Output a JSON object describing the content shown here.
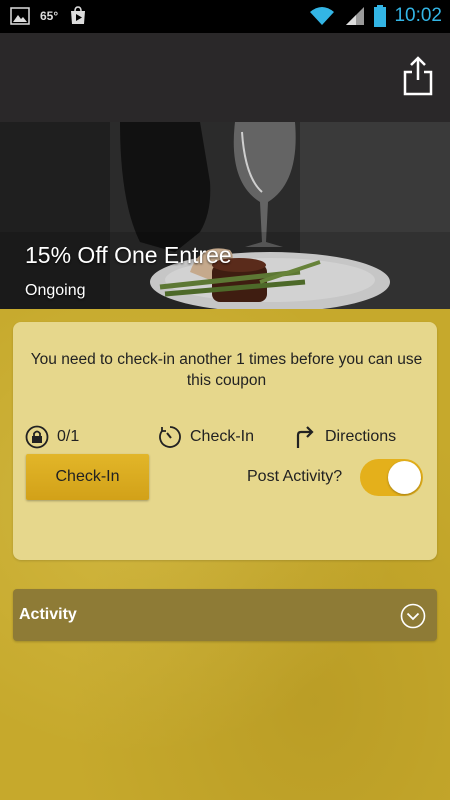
{
  "status_bar": {
    "temperature": "65°",
    "time": "10:02",
    "icons": [
      "gallery-icon",
      "play-store-icon",
      "wifi-icon",
      "signal-icon",
      "battery-icon"
    ]
  },
  "app_bar": {
    "share_icon": "share-icon"
  },
  "hero": {
    "title": "15% Off One Entree",
    "status": "Ongoing"
  },
  "card": {
    "message": "You need to check-in another 1 times before you can use this coupon",
    "progress_label": "0/1",
    "checkin_label": "Check-In",
    "directions_label": "Directions",
    "checkin_button": "Check-In",
    "post_activity_label": "Post Activity?",
    "post_activity_on": true
  },
  "activity": {
    "label": "Activity"
  },
  "colors": {
    "accent": "#e4b01b",
    "status_clock": "#33b5e5",
    "app_bar": "#2a2829",
    "background_gold": "#c6a92c"
  }
}
